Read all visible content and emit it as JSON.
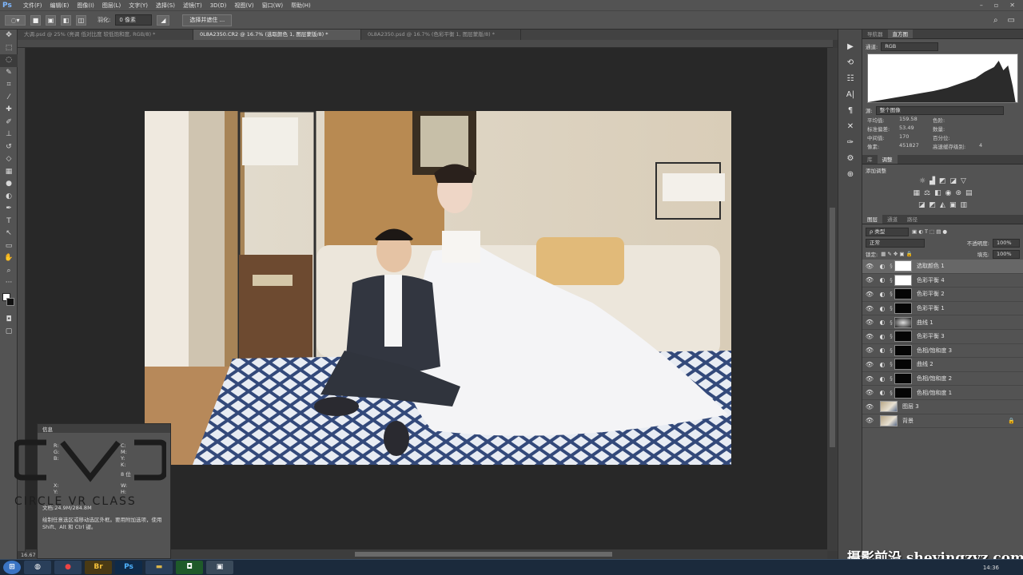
{
  "app": {
    "logo": "Ps"
  },
  "menu": [
    "文件(F)",
    "编辑(E)",
    "图像(I)",
    "图层(L)",
    "文字(Y)",
    "选择(S)",
    "滤镜(T)",
    "3D(D)",
    "视图(V)",
    "窗口(W)",
    "帮助(H)"
  ],
  "window_controls": {
    "minimize": "–",
    "restore": "▫",
    "close": "✕"
  },
  "options": {
    "feather_label": "羽化:",
    "feather_value": "0 像素",
    "anti_alias": "消除锯齿",
    "select_mask": "选择并遮住 ..."
  },
  "tabs": [
    {
      "label": "大调.psd @ 25% (亮调 低对比度 较低饱和度, RGB/8) *",
      "active": false
    },
    {
      "label": "0L8A2350.CR2 @ 16.7% (选取颜色 1, 图层蒙版/8) *",
      "active": true
    },
    {
      "label": "0L8A2350.psd @ 16.7% (色彩平衡 1, 图层蒙版/8) *",
      "active": false
    }
  ],
  "right_panel": {
    "top_tabs": [
      "导航器",
      "直方图"
    ],
    "channel_label": "通道:",
    "channel_value": "RGB",
    "source_label": "源:",
    "source_value": "整个图像",
    "stats": [
      [
        "平均值:",
        "159.58",
        "色阶:",
        ""
      ],
      [
        "标准偏差:",
        "53.49",
        "数量:",
        ""
      ],
      [
        "中间值:",
        "170",
        "百分位:",
        ""
      ],
      [
        "像素:",
        "451827",
        "高速缓存级别:",
        "4"
      ]
    ],
    "lib_tabs": [
      "库",
      "调整"
    ],
    "add_adjustment": "添加调整",
    "layer_tabs": [
      "图层",
      "通道",
      "路径"
    ],
    "filter_kind": "ρ 类型",
    "blend_mode": "正常",
    "opacity_label": "不透明度:",
    "opacity_value": "100%",
    "lock_label": "锁定:",
    "fill_label": "填充:",
    "fill_value": "100%",
    "layers": [
      {
        "name": "选取颜色 1",
        "type": "adjust",
        "mask": "white",
        "selected": true
      },
      {
        "name": "色彩平衡 4",
        "type": "adjust",
        "mask": "white",
        "selected": false
      },
      {
        "name": "色彩平衡 2",
        "type": "adjust",
        "mask": "black",
        "selected": false
      },
      {
        "name": "色彩平衡 1",
        "type": "adjust",
        "mask": "black",
        "selected": false
      },
      {
        "name": "曲线 1",
        "type": "adjust",
        "mask": "gray",
        "selected": false
      },
      {
        "name": "色彩平衡 3",
        "type": "adjust",
        "mask": "black",
        "selected": false
      },
      {
        "name": "色相/饱和度 3",
        "type": "adjust",
        "mask": "black",
        "selected": false
      },
      {
        "name": "曲线 2",
        "type": "adjust",
        "mask": "black",
        "selected": false
      },
      {
        "name": "色相/饱和度 2",
        "type": "adjust",
        "mask": "black",
        "selected": false
      },
      {
        "name": "色相/饱和度 1",
        "type": "adjust",
        "mask": "black",
        "selected": false
      },
      {
        "name": "图层 3",
        "type": "pixel",
        "mask": "",
        "selected": false
      },
      {
        "name": "背景",
        "type": "pixel",
        "mask": "",
        "selected": false
      }
    ]
  },
  "info_panel": {
    "title": "信息",
    "row1": {
      "label": "R:",
      "label2": "C:"
    },
    "row2": {
      "label": "G:",
      "label2": "M:"
    },
    "row3": {
      "label": "B:",
      "label2": "Y:"
    },
    "row4": {
      "label2": "K:"
    },
    "bits": "8 位",
    "xy_x": "X:",
    "xy_y": "Y:",
    "wh_w": "W:",
    "wh_h": "H:",
    "doc": "文档:24.9M/284.8M",
    "hint": "绘制任意选区或移动选区外框。要用附加选项，使用 Shift、Alt 和 Ctrl 键。"
  },
  "watermark_left": {
    "logo": "CVC",
    "text": "CIRCLE VR CLASS"
  },
  "watermark_right": "摄影前沿 sheyingzyz.com",
  "status_zoom": "16.67",
  "clock": "14:36"
}
